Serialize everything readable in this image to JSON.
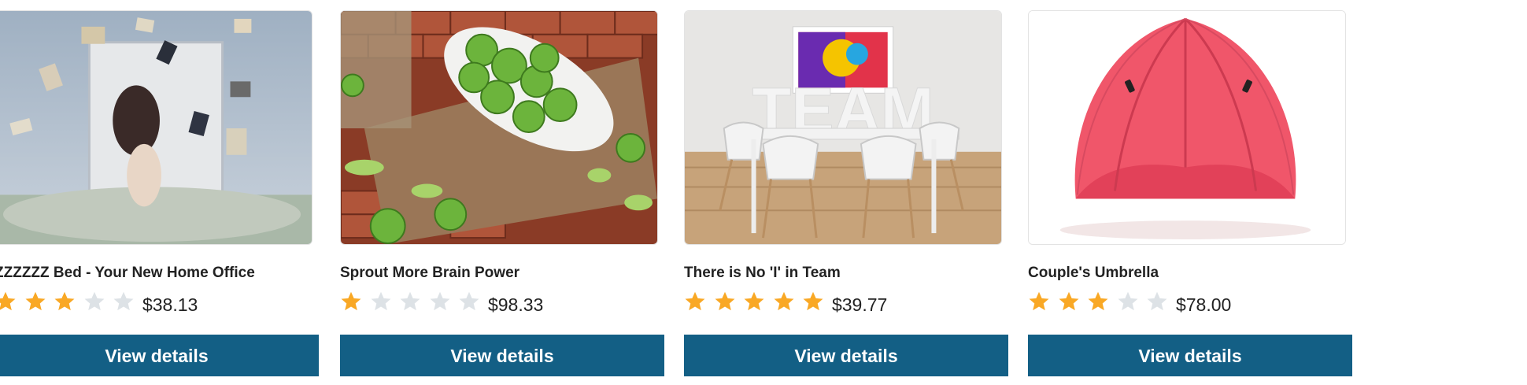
{
  "colors": {
    "button_bg": "#135f85",
    "star_filled": "#f9a825",
    "star_empty": "#dde2e6"
  },
  "products": [
    {
      "title": "ZZZZZZ Bed - Your New Home Office",
      "rating": 3,
      "max_rating": 5,
      "price": "$38.13",
      "button_label": "View details",
      "image": "woman-bed-flying-books-image"
    },
    {
      "title": "Sprout More Brain Power",
      "rating": 1,
      "max_rating": 5,
      "price": "$98.33",
      "button_label": "View details",
      "image": "brussels-sprouts-bowl-image"
    },
    {
      "title": "There is No 'I' in Team",
      "rating": 5,
      "max_rating": 5,
      "price": "$39.77",
      "button_label": "View details",
      "image": "team-office-table-image"
    },
    {
      "title": "Couple's Umbrella",
      "rating": 3,
      "max_rating": 5,
      "price": "$78.00",
      "button_label": "View details",
      "image": "red-umbrella-image"
    }
  ]
}
